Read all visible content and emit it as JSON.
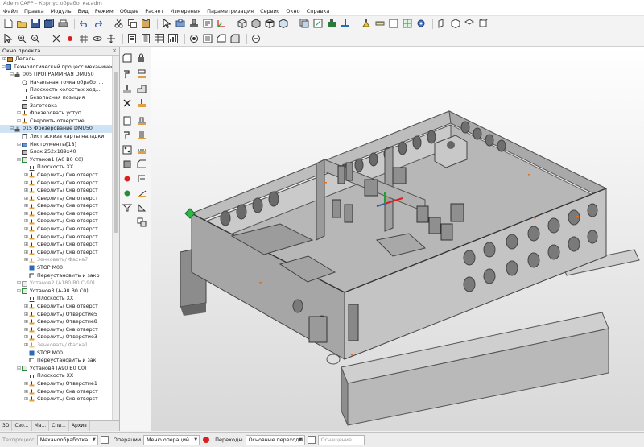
{
  "window": {
    "title": "Adem CAPP - Корпус обработка.adm"
  },
  "menu": [
    "Файл",
    "Правка",
    "Модуль",
    "Вид",
    "Режим",
    "Общие",
    "Расчет",
    "Измерения",
    "Параметризация",
    "Сервис",
    "Окно",
    "Справка"
  ],
  "panel": {
    "title": "Окно проекта",
    "close": "×",
    "tree": [
      {
        "level": 0,
        "toggle": "⊞",
        "icon": "part",
        "label": "Деталь"
      },
      {
        "level": 0,
        "toggle": "⊟",
        "icon": "process",
        "label": "Технологический процесс механическо"
      },
      {
        "level": 1,
        "toggle": "⊟",
        "icon": "machine",
        "label": "005  ПРОГРАММНАЯ DMU50"
      },
      {
        "level": 2,
        "toggle": "",
        "icon": "point",
        "label": "Начальная точка обработ..."
      },
      {
        "level": 2,
        "toggle": "",
        "icon": "plane",
        "label": "Плоскость холостых ход..."
      },
      {
        "level": 2,
        "toggle": "",
        "icon": "plane",
        "label": "Безопасная позиция"
      },
      {
        "level": 2,
        "toggle": "",
        "icon": "blank",
        "label": "Заготовка"
      },
      {
        "level": 2,
        "toggle": "⊞",
        "icon": "op",
        "label": "Фрезеровать уступ"
      },
      {
        "level": 2,
        "toggle": "⊞",
        "icon": "op",
        "label": "Сверлить отверстие"
      },
      {
        "level": 1,
        "toggle": "⊟",
        "icon": "machine",
        "label": "015  Фрезерование DMU50",
        "selected": true
      },
      {
        "level": 2,
        "toggle": "",
        "icon": "sheet",
        "label": "Лист эскиза карты наладки"
      },
      {
        "level": 2,
        "toggle": "⊞",
        "icon": "tools",
        "label": "Инструменты[18]"
      },
      {
        "level": 2,
        "toggle": "",
        "icon": "blank",
        "label": "Блок 252х189х40"
      },
      {
        "level": 2,
        "toggle": "⊟",
        "icon": "setup",
        "label": "Установ1 (А0 В0 С0)"
      },
      {
        "level": 3,
        "toggle": "",
        "icon": "plane",
        "label": "Плоскость XX"
      },
      {
        "level": 3,
        "toggle": "⊞",
        "icon": "drill",
        "label": "Сверлить/ Скв.отверст"
      },
      {
        "level": 3,
        "toggle": "⊞",
        "icon": "drill",
        "label": "Сверлить/ Скв.отверст"
      },
      {
        "level": 3,
        "toggle": "⊞",
        "icon": "drill",
        "label": "Сверлить/ Скв.отверст"
      },
      {
        "level": 3,
        "toggle": "⊞",
        "icon": "drill",
        "label": "Сверлить/ Скв.отверст"
      },
      {
        "level": 3,
        "toggle": "⊞",
        "icon": "drill",
        "label": "Сверлить/ Скв.отверст"
      },
      {
        "level": 3,
        "toggle": "⊞",
        "icon": "drill",
        "label": "Сверлить/ Скв.отверст"
      },
      {
        "level": 3,
        "toggle": "⊞",
        "icon": "drill",
        "label": "Сверлить/ Скв.отверст"
      },
      {
        "level": 3,
        "toggle": "⊞",
        "icon": "drill",
        "label": "Сверлить/ Скв.отверст"
      },
      {
        "level": 3,
        "toggle": "⊞",
        "icon": "drill",
        "label": "Сверлить/ Скв.отверст"
      },
      {
        "level": 3,
        "toggle": "⊞",
        "icon": "drill",
        "label": "Сверлить/ Скв.отверст"
      },
      {
        "level": 3,
        "toggle": "⊞",
        "icon": "drill",
        "label": "Сверлить/ Скв.отверст"
      },
      {
        "level": 3,
        "toggle": "⊞",
        "icon": "drill-dim",
        "label": "Зенковать/ Фаска7",
        "dim": true
      },
      {
        "level": 3,
        "toggle": "",
        "icon": "stop",
        "label": "STOP M00"
      },
      {
        "level": 3,
        "toggle": "",
        "icon": "reset",
        "label": "Переустановить и закр"
      },
      {
        "level": 2,
        "toggle": "⊞",
        "icon": "setup-dim",
        "label": "Установ2 (А180 В0 С-90)",
        "dim": true
      },
      {
        "level": 2,
        "toggle": "⊟",
        "icon": "setup",
        "label": "Установ3 (А-90 В0 С0)"
      },
      {
        "level": 3,
        "toggle": "",
        "icon": "plane",
        "label": "Плоскость XX"
      },
      {
        "level": 3,
        "toggle": "⊞",
        "icon": "drill",
        "label": "Сверлить/ Скв.отверст"
      },
      {
        "level": 3,
        "toggle": "⊞",
        "icon": "drill",
        "label": "Сверлить/ Отверстие5"
      },
      {
        "level": 3,
        "toggle": "⊞",
        "icon": "drill",
        "label": "Сверлить/ Отверстие8"
      },
      {
        "level": 3,
        "toggle": "⊞",
        "icon": "drill",
        "label": "Сверлить/ Скв.отверст"
      },
      {
        "level": 3,
        "toggle": "⊞",
        "icon": "drill",
        "label": "Сверлить/ Отверстие3"
      },
      {
        "level": 3,
        "toggle": "⊞",
        "icon": "drill-dim",
        "label": "Зенковать/ Фаска1",
        "dim": true
      },
      {
        "level": 3,
        "toggle": "",
        "icon": "stop",
        "label": "STOP M00"
      },
      {
        "level": 3,
        "toggle": "",
        "icon": "reset",
        "label": "Переустановить и зак"
      },
      {
        "level": 2,
        "toggle": "⊟",
        "icon": "setup",
        "label": "Установ4 (А90 В0 С0)"
      },
      {
        "level": 3,
        "toggle": "",
        "icon": "plane",
        "label": "Плоскость XX"
      },
      {
        "level": 3,
        "toggle": "⊞",
        "icon": "drill",
        "label": "Сверлить/ Отверстие1"
      },
      {
        "level": 3,
        "toggle": "⊞",
        "icon": "drill",
        "label": "Сверлить/ Скв.отверст"
      },
      {
        "level": 3,
        "toggle": "⊞",
        "icon": "drill",
        "label": "Сверлить/ Скв.отверст"
      }
    ],
    "tabs": [
      "3D",
      "Сво...",
      "Ма...",
      "Спи...",
      "Архив"
    ]
  },
  "status": {
    "techprocess_label": "Техпроцесс",
    "techprocess_value": "Механообработка",
    "operations_label": "Операции",
    "operations_value": "Меню операций",
    "transitions_label": "Переходы",
    "transitions_value": "Основные переходы",
    "notice_value": "Оснащение"
  },
  "colors": {
    "accent_red": "#e02020",
    "selection": "#cfe3f7",
    "model_gray": "#b4b4b4"
  }
}
